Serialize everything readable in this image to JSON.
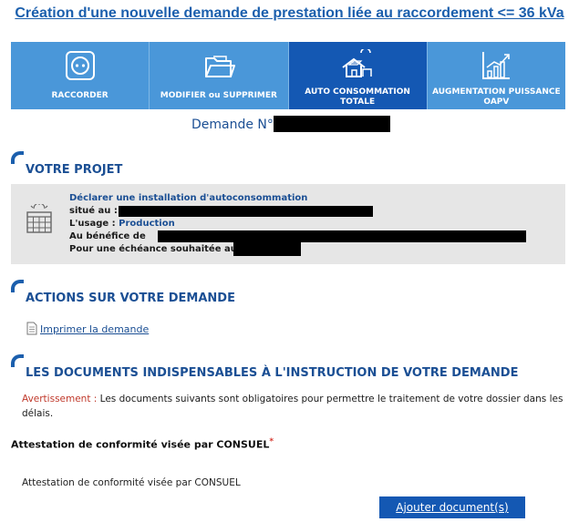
{
  "page_title": "Création d'une nouvelle demande de prestation liée au raccordement <= 36 kVa",
  "tabs": [
    {
      "label": "RACCORDER",
      "icon": "outlet-icon"
    },
    {
      "label": "MODIFIER ou SUPPRIMER",
      "icon": "folder-icon"
    },
    {
      "label": "AUTO CONSOMMATION TOTALE",
      "icon": "solar-house-icon",
      "active": true
    },
    {
      "label": "AUGMENTATION PUISSANCE OAPV",
      "icon": "chart-growth-icon"
    }
  ],
  "demande_label": "Demande N°",
  "sections": {
    "projet": "VOTRE PROJET",
    "actions": "ACTIONS SUR VOTRE DEMANDE",
    "documents": "LES DOCUMENTS INDISPENSABLES À L'INSTRUCTION DE VOTRE DEMANDE"
  },
  "project": {
    "title": "Déclarer une installation d'autoconsommation",
    "situe_label": "situé au :",
    "usage_label": "L'usage :",
    "usage_value": "Production",
    "benefice_label": "Au bénéfice de",
    "echeance_label": "Pour une échéance souhaitée au"
  },
  "actions": {
    "print_label": "Imprimer la demande"
  },
  "documents": {
    "warning_label": "Avertissement :",
    "warning_text": " Les documents suivants sont obligatoires pour permettre le traitement de votre dossier dans les délais.",
    "attest_title": "Attestation de conformité visée par CONSUEL",
    "required_mark": "*",
    "attest_item": "Attestation de conformité visée par CONSUEL",
    "add_button": "Ajouter document(s)"
  },
  "colors": {
    "tab": "#4a97d9",
    "tab_active": "#1458b3",
    "heading": "#1b4f94",
    "warning": "#c0392b"
  }
}
